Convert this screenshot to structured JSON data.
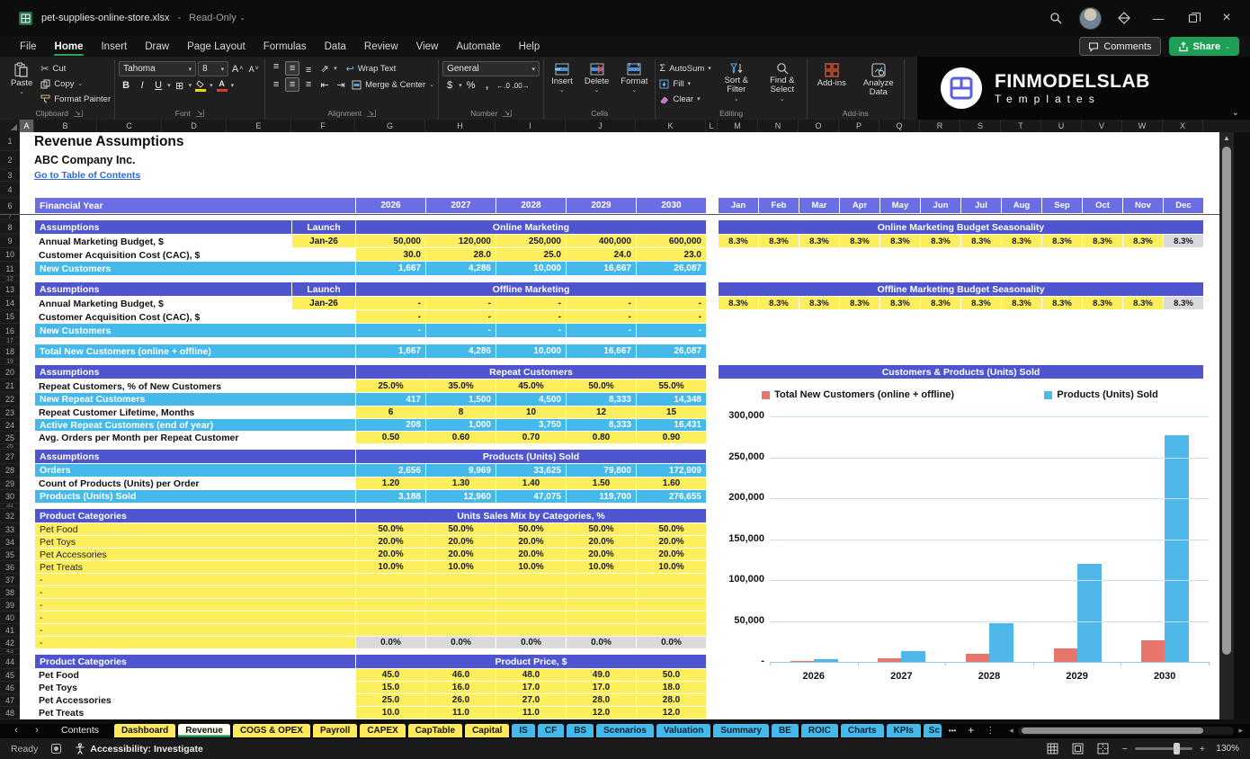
{
  "window": {
    "file": "pet-supplies-online-store.xlsx",
    "separator": "-",
    "mode": "Read-Only"
  },
  "icons": {
    "chevron_down": "⌄",
    "dropdown": "▾",
    "launcher": "↘",
    "cut": "✂",
    "autosum": "Σ",
    "bold": "B",
    "italic": "I",
    "underline": "U",
    "borders": "⊞",
    "align": "≡",
    "indent_left": "⇤",
    "indent_right": "⇥",
    "wrap": "↩",
    "orient": "⇗",
    "dollar": "$",
    "percent": "%",
    "comma": ",",
    "inc_decimal": "←.0",
    "dec_decimal": ".00→",
    "font_letter": "A",
    "caret_up": "˄",
    "caret_down": "˅",
    "more_sheets": "•••",
    "add_sheet": "+",
    "menu_dots": "⋮",
    "nav_left": "‹",
    "nav_right": "›",
    "scroll_left": "◂",
    "scroll_right": "▸",
    "up_arrow": "▲",
    "minimize": "—",
    "close": "×",
    "minus": "−",
    "plus": "+"
  },
  "menu": {
    "items": [
      "File",
      "Home",
      "Insert",
      "Draw",
      "Page Layout",
      "Formulas",
      "Data",
      "Review",
      "View",
      "Automate",
      "Help"
    ],
    "active": "Home",
    "comments": "Comments",
    "share": "Share"
  },
  "ribbon": {
    "clipboard": {
      "name": "Clipboard",
      "paste": "Paste",
      "cut": "Cut",
      "copy": "Copy",
      "format_painter": "Format Painter"
    },
    "font": {
      "name": "Font",
      "family": "Tahoma",
      "size": "8"
    },
    "alignment": {
      "name": "Alignment",
      "wrap": "Wrap Text",
      "merge": "Merge & Center"
    },
    "number": {
      "name": "Number",
      "format": "General"
    },
    "cells": {
      "name": "Cells",
      "insert": "Insert",
      "delete": "Delete",
      "format": "Format"
    },
    "editing": {
      "name": "Editing",
      "autosum": "AutoSum",
      "fill": "Fill",
      "clear": "Clear",
      "sort": "Sort & Filter",
      "find": "Find & Select"
    },
    "addins": {
      "name": "Add-ins",
      "addins": "Add-ins",
      "analyze": "Analyze Data"
    }
  },
  "logo": {
    "line1": "FINMODELSLAB",
    "line2": "Templates"
  },
  "sheet": {
    "columns": [
      "A",
      "B",
      "C",
      "D",
      "E",
      "F",
      "G",
      "H",
      "I",
      "J",
      "K",
      "L",
      "M",
      "N",
      "O",
      "P",
      "Q",
      "R",
      "S",
      "T",
      "U",
      "V",
      "W",
      "X"
    ],
    "financial_year_label": "Financial Year",
    "years": [
      "2026",
      "2027",
      "2028",
      "2029",
      "2030"
    ],
    "months": [
      "Jan",
      "Feb",
      "Mar",
      "Apr",
      "May",
      "Jun",
      "Jul",
      "Aug",
      "Sep",
      "Oct",
      "Nov",
      "Dec"
    ],
    "rows": [
      {
        "k": "title",
        "n": "1",
        "h": 21,
        "label": "Revenue Assumptions"
      },
      {
        "k": "subtitle",
        "n": "2",
        "h": 20,
        "label": "ABC Company Inc."
      },
      {
        "k": "link",
        "n": "3",
        "h": 14,
        "label": "Go to Table of Contents"
      },
      {
        "k": "blank",
        "n": "4",
        "h": 18
      },
      {
        "k": "yearhdr",
        "n": "6",
        "h": 18
      },
      {
        "k": "blank",
        "n": "7",
        "h": 7
      },
      {
        "k": "section",
        "n": "8",
        "h": 16,
        "label": "Assumptions",
        "launch_label": "Launch",
        "title": "Online Marketing",
        "right": "season",
        "season": "online"
      },
      {
        "k": "row",
        "n": "9",
        "h": 15,
        "label": "Annual Marketing Budget, $",
        "lcls": "b",
        "launch": "Jan-26",
        "vcls": "yr",
        "values": [
          "50,000",
          "120,000",
          "250,000",
          "400,000",
          "600,000"
        ],
        "right": "vals",
        "season": "online"
      },
      {
        "k": "row",
        "n": "10",
        "h": 15,
        "label": "Customer Acquisition Cost (CAC), $",
        "lcls": "b",
        "vcls": "yr",
        "values": [
          "30.0",
          "28.0",
          "25.0",
          "24.0",
          "23.0"
        ]
      },
      {
        "k": "row",
        "n": "11",
        "h": 16,
        "label": "New Customers",
        "lcls": "c",
        "vcls": "cy",
        "values": [
          "1,667",
          "4,286",
          "10,000",
          "16,667",
          "26,087"
        ]
      },
      {
        "k": "blank",
        "n": "12",
        "h": 7
      },
      {
        "k": "section",
        "n": "13",
        "h": 16,
        "label": "Assumptions",
        "launch_label": "Launch",
        "title": "Offline Marketing",
        "right": "season",
        "season": "offline"
      },
      {
        "k": "row",
        "n": "14",
        "h": 15,
        "label": "Annual Marketing Budget, $",
        "lcls": "b",
        "launch": "Jan-26",
        "vcls": "yr",
        "values": [
          "-",
          "-",
          "-",
          "-",
          "-"
        ],
        "right": "vals",
        "season": "offline"
      },
      {
        "k": "row",
        "n": "15",
        "h": 15,
        "label": "Customer Acquisition Cost (CAC), $",
        "lcls": "b",
        "vcls": "yr",
        "values": [
          "-",
          "-",
          "-",
          "-",
          "-"
        ]
      },
      {
        "k": "row",
        "n": "16",
        "h": 16,
        "label": "New Customers",
        "lcls": "c",
        "vcls": "cy",
        "values": [
          "-",
          "-",
          "-",
          "-",
          "-"
        ]
      },
      {
        "k": "blank",
        "n": "17",
        "h": 7
      },
      {
        "k": "row",
        "n": "18",
        "h": 16,
        "label": "Total New Customers (online + offline)",
        "lcls": "c",
        "vcls": "cy",
        "values": [
          "1,667",
          "4,286",
          "10,000",
          "16,667",
          "26,087"
        ]
      },
      {
        "k": "blank",
        "n": "19",
        "h": 7
      },
      {
        "k": "section",
        "n": "20",
        "h": 16,
        "label": "Assumptions",
        "title": "Repeat Customers",
        "right": "chart"
      },
      {
        "k": "row",
        "n": "21",
        "h": 15,
        "label": "Repeat Customers, % of New Customers",
        "lcls": "b",
        "vcls": "yc",
        "values": [
          "25.0%",
          "35.0%",
          "45.0%",
          "50.0%",
          "55.0%"
        ]
      },
      {
        "k": "row",
        "n": "22",
        "h": 15,
        "label": "New Repeat Customers",
        "lcls": "c",
        "vcls": "cy",
        "values": [
          "417",
          "1,500",
          "4,500",
          "8,333",
          "14,348"
        ]
      },
      {
        "k": "row",
        "n": "23",
        "h": 14,
        "label": "Repeat Customer Lifetime, Months",
        "lcls": "b",
        "vcls": "yc",
        "values": [
          "6",
          "8",
          "10",
          "12",
          "15"
        ]
      },
      {
        "k": "row",
        "n": "24",
        "h": 14,
        "label": "Active Repeat Customers (end of year)",
        "lcls": "c",
        "vcls": "cy",
        "values": [
          "208",
          "1,000",
          "3,750",
          "8,333",
          "16,431"
        ]
      },
      {
        "k": "row",
        "n": "25",
        "h": 14,
        "label": "Avg. Orders per Month per Repeat Customer",
        "lcls": "b",
        "vcls": "yc",
        "values": [
          "0.50",
          "0.60",
          "0.70",
          "0.80",
          "0.90"
        ]
      },
      {
        "k": "blank",
        "n": "26",
        "h": 6
      },
      {
        "k": "section",
        "n": "27",
        "h": 16,
        "label": "Assumptions",
        "title": "Products (Units) Sold"
      },
      {
        "k": "row",
        "n": "28",
        "h": 15,
        "label": "Orders",
        "lcls": "c",
        "vcls": "cy",
        "values": [
          "2,656",
          "9,969",
          "33,625",
          "79,800",
          "172,909"
        ]
      },
      {
        "k": "row",
        "n": "29",
        "h": 14,
        "label": "Count of Products (Units) per Order",
        "lcls": "b",
        "vcls": "yc",
        "values": [
          "1.20",
          "1.30",
          "1.40",
          "1.50",
          "1.60"
        ]
      },
      {
        "k": "row",
        "n": "30",
        "h": 15,
        "label": "Products (Units) Sold",
        "lcls": "c",
        "vcls": "cy",
        "values": [
          "3,188",
          "12,960",
          "47,075",
          "119,700",
          "276,655"
        ]
      },
      {
        "k": "blank",
        "n": "31",
        "h": 6
      },
      {
        "k": "section",
        "n": "32",
        "h": 16,
        "label": "Product Categories",
        "title": "Units Sales Mix by Categories, %"
      },
      {
        "k": "row",
        "n": "33",
        "h": 14,
        "label": "Pet Food",
        "lcls": "y",
        "vcls": "yc",
        "values": [
          "50.0%",
          "50.0%",
          "50.0%",
          "50.0%",
          "50.0%"
        ]
      },
      {
        "k": "row",
        "n": "34",
        "h": 14,
        "label": "Pet Toys",
        "lcls": "y",
        "vcls": "yc",
        "values": [
          "20.0%",
          "20.0%",
          "20.0%",
          "20.0%",
          "20.0%"
        ]
      },
      {
        "k": "row",
        "n": "35",
        "h": 14,
        "label": "Pet Accessories",
        "lcls": "y",
        "vcls": "yc",
        "values": [
          "20.0%",
          "20.0%",
          "20.0%",
          "20.0%",
          "20.0%"
        ]
      },
      {
        "k": "row",
        "n": "36",
        "h": 14,
        "label": "Pet Treats",
        "lcls": "y",
        "vcls": "yc",
        "values": [
          "10.0%",
          "10.0%",
          "10.0%",
          "10.0%",
          "10.0%"
        ]
      },
      {
        "k": "row",
        "n": "37",
        "h": 14,
        "label": "-",
        "lcls": "y",
        "vcls": "ye",
        "values": [
          "",
          "",
          "",
          "",
          ""
        ]
      },
      {
        "k": "row",
        "n": "38",
        "h": 14,
        "label": "-",
        "lcls": "y",
        "vcls": "ye",
        "values": [
          "",
          "",
          "",
          "",
          ""
        ]
      },
      {
        "k": "row",
        "n": "39",
        "h": 14,
        "label": "-",
        "lcls": "y",
        "vcls": "ye",
        "values": [
          "",
          "",
          "",
          "",
          ""
        ]
      },
      {
        "k": "row",
        "n": "40",
        "h": 14,
        "label": "-",
        "lcls": "y",
        "vcls": "ye",
        "values": [
          "",
          "",
          "",
          "",
          ""
        ]
      },
      {
        "k": "row",
        "n": "41",
        "h": 14,
        "label": "-",
        "lcls": "y",
        "vcls": "ye",
        "values": [
          "",
          "",
          "",
          "",
          ""
        ]
      },
      {
        "k": "row",
        "n": "42",
        "h": 14,
        "label": "-",
        "lcls": "y",
        "vcls": "gc",
        "values": [
          "0.0%",
          "0.0%",
          "0.0%",
          "0.0%",
          "0.0%"
        ]
      },
      {
        "k": "blank",
        "n": "43",
        "h": 6
      },
      {
        "k": "section",
        "n": "44",
        "h": 16,
        "label": "Product Categories",
        "title": "Product Price, $"
      },
      {
        "k": "row",
        "n": "45",
        "h": 14,
        "label": "Pet Food",
        "lcls": "b",
        "vcls": "yc",
        "values": [
          "45.0",
          "46.0",
          "48.0",
          "49.0",
          "50.0"
        ]
      },
      {
        "k": "row",
        "n": "46",
        "h": 14,
        "label": "Pet Toys",
        "lcls": "b",
        "vcls": "yc",
        "values": [
          "15.0",
          "16.0",
          "17.0",
          "17.0",
          "18.0"
        ]
      },
      {
        "k": "row",
        "n": "47",
        "h": 14,
        "label": "Pet Accessories",
        "lcls": "b",
        "vcls": "yc",
        "values": [
          "25.0",
          "26.0",
          "27.0",
          "28.0",
          "28.0"
        ]
      },
      {
        "k": "row",
        "n": "48",
        "h": 14,
        "label": "Pet Treats",
        "lcls": "b",
        "vcls": "yc",
        "values": [
          "10.0",
          "11.0",
          "11.0",
          "12.0",
          "12.0"
        ]
      }
    ]
  },
  "seasonality": {
    "online": {
      "title": "Online Marketing Budget Seasonality",
      "values": [
        "8.3%",
        "8.3%",
        "8.3%",
        "8.3%",
        "8.3%",
        "8.3%",
        "8.3%",
        "8.3%",
        "8.3%",
        "8.3%",
        "8.3%",
        "8.3%"
      ]
    },
    "offline": {
      "title": "Offline Marketing Budget Seasonality",
      "values": [
        "8.3%",
        "8.3%",
        "8.3%",
        "8.3%",
        "8.3%",
        "8.3%",
        "8.3%",
        "8.3%",
        "8.3%",
        "8.3%",
        "8.3%",
        "8.3%"
      ]
    }
  },
  "chart_data": {
    "type": "bar",
    "title": "Customers & Products (Units) Sold",
    "categories": [
      "2026",
      "2027",
      "2028",
      "2029",
      "2030"
    ],
    "series": [
      {
        "name": "Total New Customers (online + offline)",
        "color": "#E8756B",
        "values": [
          1667,
          4286,
          10000,
          16667,
          26087
        ]
      },
      {
        "name": "Products (Units) Sold",
        "color": "#4FB8E8",
        "values": [
          3188,
          12960,
          47075,
          119700,
          276655
        ]
      }
    ],
    "ylim": [
      0,
      300000
    ],
    "ytick_interval": 50000,
    "ytick_labels": [
      "-",
      "50,000",
      "100,000",
      "150,000",
      "200,000",
      "250,000",
      "300,000"
    ],
    "grid": true,
    "legend_position": "top"
  },
  "tabs": [
    {
      "label": "Contents",
      "style": "plain"
    },
    {
      "label": "Dashboard",
      "style": "yellow"
    },
    {
      "label": "Revenue",
      "style": "active"
    },
    {
      "label": "COGS & OPEX",
      "style": "yellow"
    },
    {
      "label": "Payroll",
      "style": "yellow"
    },
    {
      "label": "CAPEX",
      "style": "yellow"
    },
    {
      "label": "CapTable",
      "style": "yellow"
    },
    {
      "label": "Capital",
      "style": "yellow"
    },
    {
      "label": "IS",
      "style": "blue"
    },
    {
      "label": "CF",
      "style": "blue"
    },
    {
      "label": "BS",
      "style": "blue"
    },
    {
      "label": "Scenarios",
      "style": "blue"
    },
    {
      "label": "Valuation",
      "style": "blue"
    },
    {
      "label": "Summary",
      "style": "blue"
    },
    {
      "label": "BE",
      "style": "blue"
    },
    {
      "label": "ROIC",
      "style": "blue"
    },
    {
      "label": "Charts",
      "style": "blue"
    },
    {
      "label": "KPIs",
      "style": "blue"
    },
    {
      "label": "Sc",
      "style": "blue",
      "clipped": true
    }
  ],
  "status": {
    "ready": "Ready",
    "accessibility": "Accessibility: Investigate",
    "zoom": "130%"
  }
}
